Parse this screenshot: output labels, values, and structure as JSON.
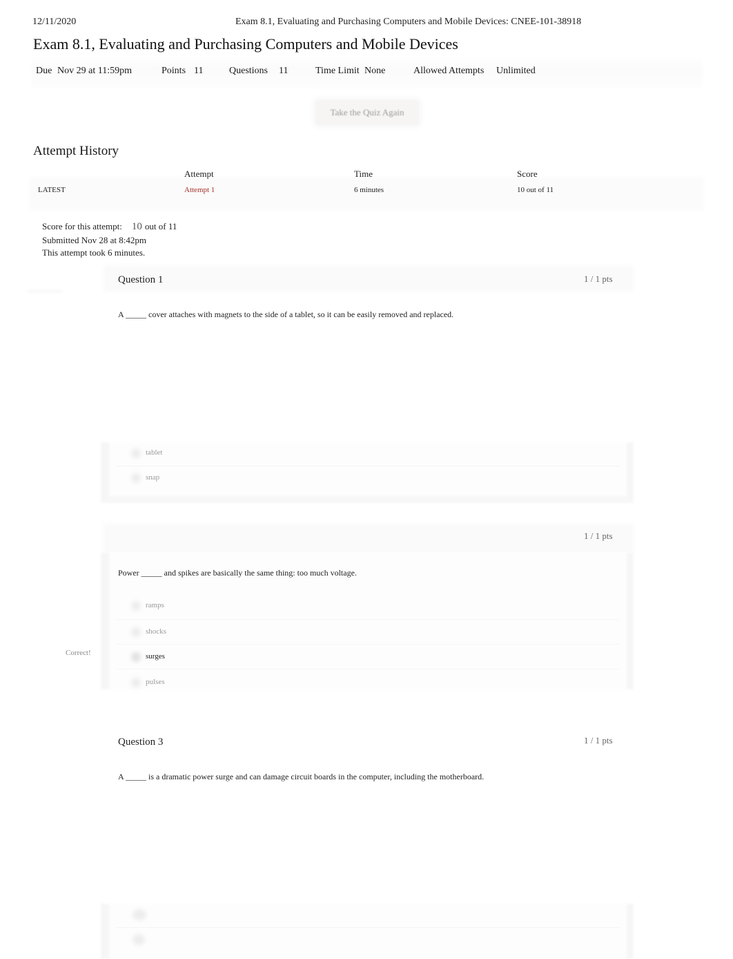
{
  "print_header": {
    "date": "12/11/2020",
    "title": "Exam 8.1, Evaluating and Purchasing Computers and Mobile Devices: CNEE-101-38918"
  },
  "page_title": "Exam 8.1, Evaluating and Purchasing Computers and Mobile Devices",
  "details": {
    "due_label": "Due",
    "due_value": "Nov 29 at 11:59pm",
    "points_label": "Points",
    "points_value": "11",
    "questions_label": "Questions",
    "questions_value": "11",
    "time_limit_label": "Time Limit",
    "time_limit_value": "None",
    "allowed_attempts_label": "Allowed Attempts",
    "allowed_attempts_value": "Unlimited"
  },
  "take_quiz_button": "Take the Quiz Again",
  "attempt_history": {
    "title": "Attempt History",
    "columns": [
      "",
      "Attempt",
      "Time",
      "Score"
    ],
    "rows": [
      {
        "tag": "LATEST",
        "attempt": "Attempt 1",
        "time": "6 minutes",
        "score": "10 out of 11"
      }
    ]
  },
  "attempt_summary": {
    "score_label": "Score for this attempt:",
    "score_value": "10",
    "score_out_of": "out of 11",
    "submitted": "Submitted Nov 28 at 8:42pm",
    "duration": "This attempt took 6 minutes."
  },
  "questions": [
    {
      "title": "Question 1",
      "points": "1 / 1 pts",
      "text": "A _____ cover attaches with magnets to the side of a tablet, so it can be easily removed and replaced.",
      "answers": [
        {
          "label": "tablet",
          "selected": false
        },
        {
          "label": "snap",
          "selected": false
        }
      ]
    },
    {
      "title": "",
      "points": "1 / 1 pts",
      "text": "Power _____ and spikes are basically the same thing: too much voltage.",
      "feedback": "Correct!",
      "answers": [
        {
          "label": "ramps",
          "selected": false
        },
        {
          "label": "shocks",
          "selected": false
        },
        {
          "label": "surges",
          "selected": true
        },
        {
          "label": "pulses",
          "selected": false
        }
      ]
    },
    {
      "title": "Question 3",
      "points": "1 / 1 pts",
      "text": "A _____ is a dramatic power surge and can damage circuit boards in the computer, including the motherboard.",
      "answers": [
        {
          "label": "",
          "selected": false
        },
        {
          "label": "",
          "selected": false
        }
      ]
    }
  ],
  "colors": {
    "link": "#a3302a",
    "muted_text": "#9a9a9a",
    "points_text": "#666666"
  }
}
